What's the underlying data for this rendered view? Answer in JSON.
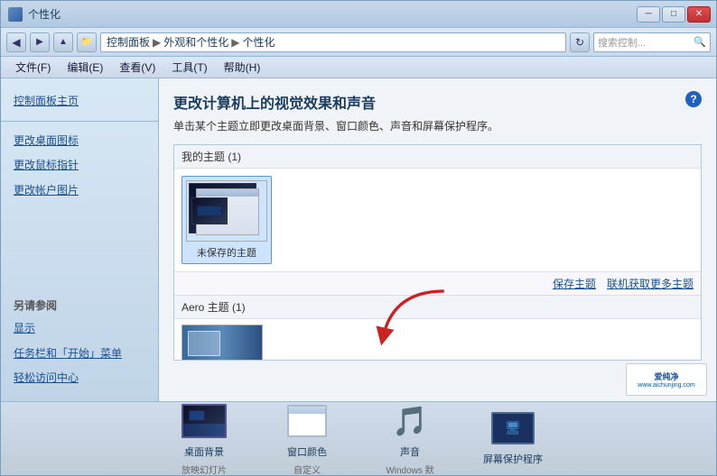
{
  "window": {
    "title": "个性化",
    "controls": {
      "minimize": "─",
      "maximize": "□",
      "close": "✕"
    }
  },
  "addressbar": {
    "breadcrumb": {
      "part1": "控制面板",
      "sep1": "▶",
      "part2": "外观和个性化",
      "sep2": "▶",
      "part3": "个性化"
    },
    "search_placeholder": "搜索控制..."
  },
  "menu": {
    "items": [
      "文件(F)",
      "编辑(E)",
      "查看(V)",
      "工具(T)",
      "帮助(H)"
    ]
  },
  "sidebar": {
    "main_link": "控制面板主页",
    "links": [
      "更改桌面图标",
      "更改鼠标指针",
      "更改帐户图片"
    ],
    "section_title": "另请参阅",
    "section_links": [
      "显示",
      "任务栏和「开始」菜单",
      "轻松访问中心"
    ]
  },
  "content": {
    "title": "更改计算机上的视觉效果和声音",
    "description": "单击某个主题立即更改桌面背景、窗口颜色、声音和屏幕保护程序。",
    "my_themes": {
      "label": "我的主题 (1)",
      "items": [
        {
          "name": "未保存的主题",
          "selected": true
        }
      ]
    },
    "links": {
      "save_theme": "保存主题",
      "get_more": "联机获取更多主题"
    },
    "aero_themes": {
      "label": "Aero 主题 (1)"
    }
  },
  "toolbar": {
    "items": [
      {
        "label": "桌面背景",
        "sublabel": "放映幻灯片",
        "icon": "desktop-bg-icon"
      },
      {
        "label": "窗口颜色",
        "sublabel": "自定义",
        "icon": "window-color-icon"
      },
      {
        "label": "声音",
        "sublabel": "Windows 默",
        "icon": "sound-icon"
      },
      {
        "label": "屏幕保护程序",
        "sublabel": "",
        "icon": "screen-saver-icon"
      }
    ]
  },
  "colors": {
    "accent": "#1a5090",
    "sidebar_bg": "#d0e0f0",
    "content_bg": "#f0f4f8",
    "titlebar": "#c8d8ea"
  }
}
